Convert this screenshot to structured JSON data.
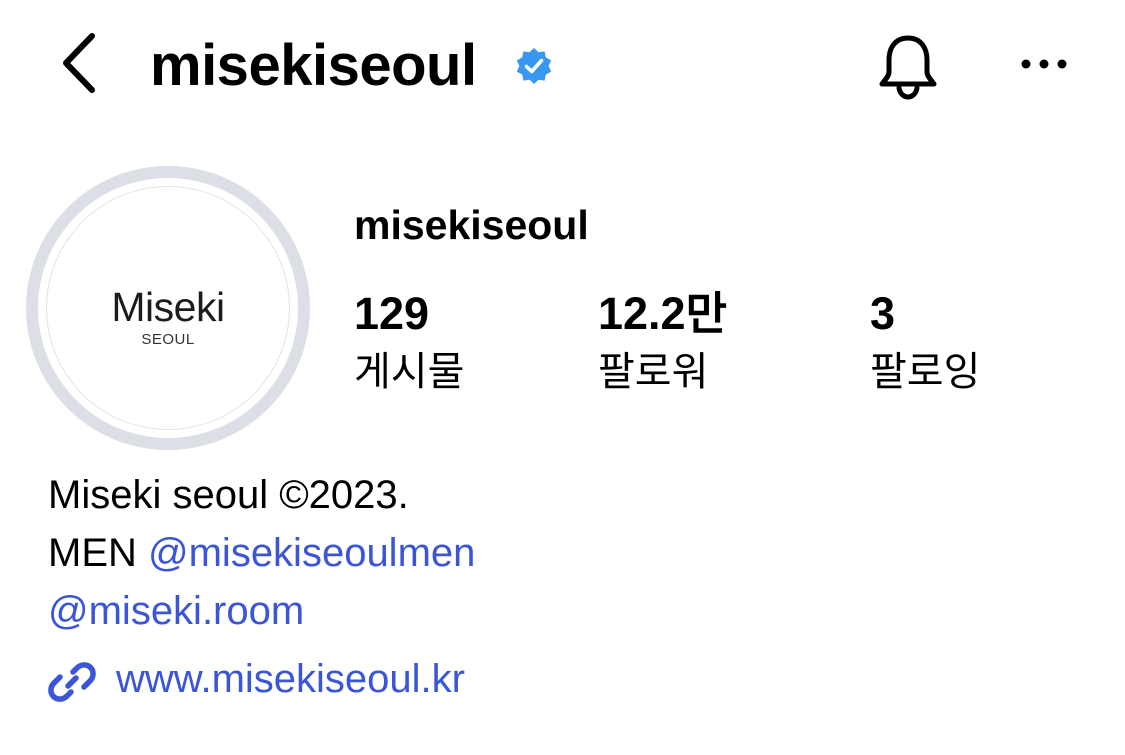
{
  "header": {
    "title": "misekiseoul",
    "back_icon": "chevron-left-icon",
    "verified_icon": "verified-badge-icon",
    "bell_icon": "bell-icon",
    "more_icon": "more-horizontal-icon"
  },
  "avatar": {
    "brand": "Miseki",
    "sub": "SEOUL"
  },
  "profile": {
    "username": "misekiseoul",
    "stats": [
      {
        "value": "129",
        "label": "게시물"
      },
      {
        "value": "12.2만",
        "label": "팔로워"
      },
      {
        "value": "3",
        "label": "팔로잉"
      }
    ]
  },
  "bio": {
    "line1": "Miseki seoul ©2023.",
    "line2_prefix": "MEN ",
    "line2_mention": "@misekiseoulmen",
    "line3_mention": "@miseki.room",
    "link_icon": "link-icon",
    "website": "www.misekiseoul.kr"
  },
  "colors": {
    "link": "#3b55d9",
    "verified": "#3897f0",
    "avatar_ring": "#dcdfe6"
  }
}
